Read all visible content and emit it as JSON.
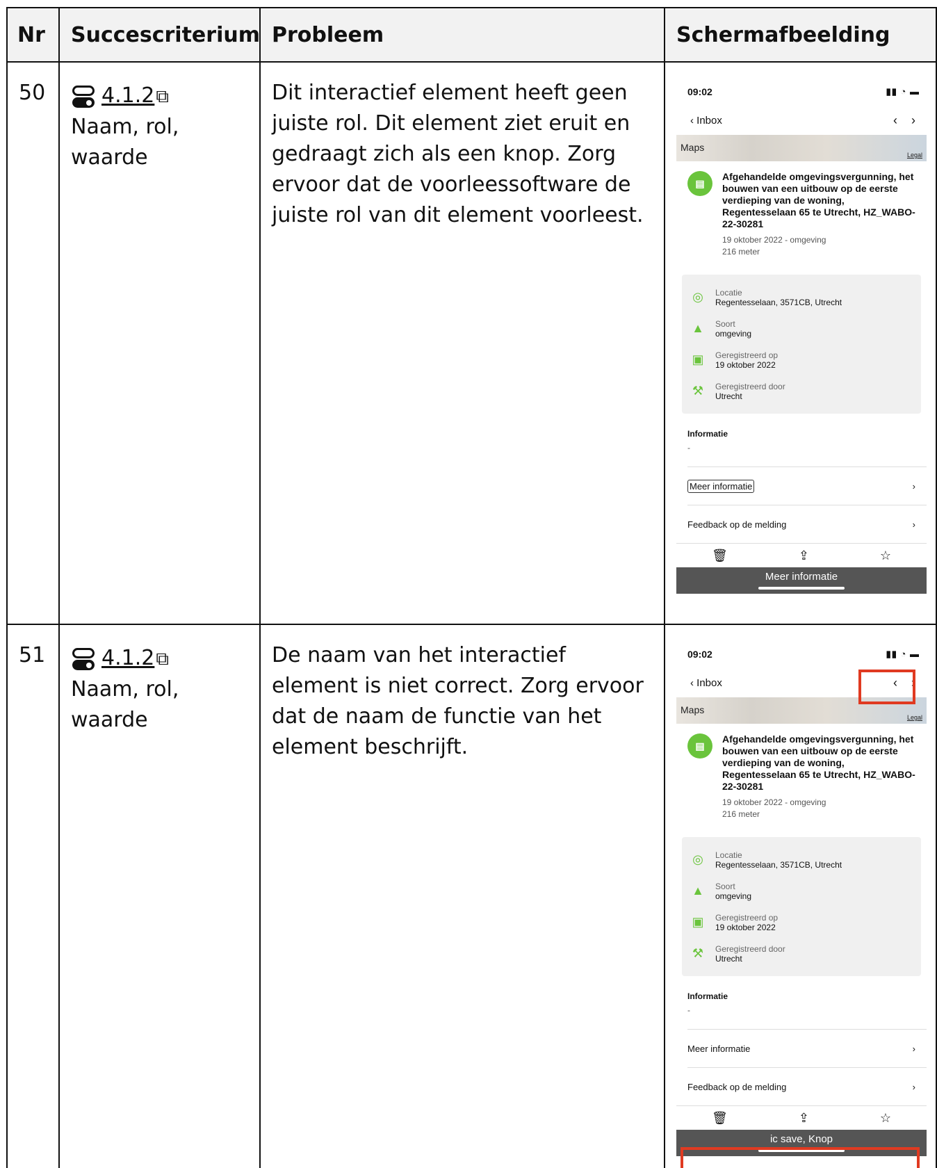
{
  "headers": {
    "nr": "Nr",
    "succescriterium": "Succescriterium",
    "probleem": "Probleem",
    "schermafbeelding": "Schermafbeelding"
  },
  "rows": [
    {
      "nr": "50",
      "criterium_code": "4.1.2",
      "criterium_name": "Naam, rol, waarde",
      "probleem": "Dit interactief element heeft geen juiste rol. Dit element ziet eruit en gedraagt zich als een knop. Zorg ervoor dat de voorleessoftware de juiste rol van dit element voorleest.",
      "voiceover": "Meer informatie"
    },
    {
      "nr": "51",
      "criterium_code": "4.1.2",
      "criterium_name": "Naam, rol, waarde",
      "probleem": "De naam van het interactief element is niet correct. Zorg ervoor dat de naam de functie van het element beschrijft.",
      "voiceover": "ic save, Knop"
    }
  ],
  "phone": {
    "time": "09:02",
    "back": "Inbox",
    "maps": "Maps",
    "legal": "Legal",
    "title": "Afgehandelde omgevingsvergunning, het bouwen van een uitbouw op de eerste verdieping van de woning, Regentesselaan 65 te Utrecht, HZ_WABO-22-30281",
    "date_line": "19 oktober 2022 - omgeving",
    "distance": "216 meter",
    "details": [
      {
        "key": "Locatie",
        "value": "Regentesselaan, 3571CB, Utrecht",
        "icon": "target-icon"
      },
      {
        "key": "Soort",
        "value": "omgeving",
        "icon": "shapes-icon"
      },
      {
        "key": "Geregistreerd op",
        "value": "19 oktober 2022",
        "icon": "calendar-icon"
      },
      {
        "key": "Geregistreerd door",
        "value": "Utrecht",
        "icon": "gavel-icon"
      }
    ],
    "info_heading": "Informatie",
    "info_value": "-",
    "link_more": "Meer informatie",
    "link_feedback": "Feedback op de melding"
  },
  "accent": "#6ac43c",
  "highlight": "#e03a21"
}
